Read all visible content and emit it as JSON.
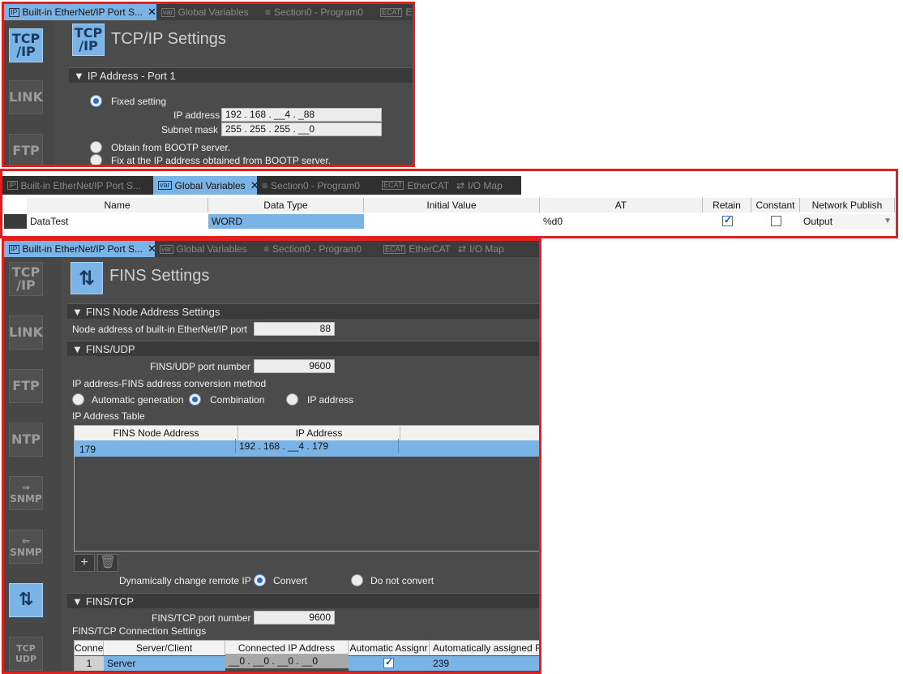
{
  "panel1": {
    "tabs": [
      {
        "icon": "IP",
        "label": "Built-in EtherNet/IP Port S...",
        "active": true,
        "closable": true
      },
      {
        "icon": "var",
        "label": "Global Variables",
        "active": false
      },
      {
        "icon": "",
        "label": "Section0 - Program0",
        "active": false
      },
      {
        "icon": "ECAT",
        "label": "Et",
        "active": false
      }
    ],
    "sidebar": [
      {
        "name": "tcpip",
        "line1": "TCP",
        "line2": "/IP",
        "selected": true
      },
      {
        "name": "link",
        "line1": "LINK",
        "line2": "",
        "selected": false
      },
      {
        "name": "ftp",
        "line1": "FTP",
        "line2": "",
        "selected": false
      }
    ],
    "header_icon": {
      "line1": "TCP",
      "line2": "/IP"
    },
    "title": "TCP/IP Settings",
    "section": "IP Address - Port 1",
    "fixed_setting_label": "Fixed setting",
    "ip_address_label": "IP address",
    "ip_address_value": "192 . 168 . __4 . _88",
    "subnet_mask_label": "Subnet mask",
    "subnet_mask_value": "255 . 255 . 255 . __0",
    "bootp_label": "Obtain from BOOTP server.",
    "fix_bootp_label": "Fix at the IP address obtained from BOOTP server."
  },
  "panel2": {
    "tabs": [
      {
        "icon": "IP",
        "label": "Built-in EtherNet/IP Port S...",
        "active": false
      },
      {
        "icon": "var",
        "label": "Global Variables",
        "active": true,
        "closable": true
      },
      {
        "icon": "",
        "label": "Section0 - Program0",
        "active": false
      },
      {
        "icon": "ECAT",
        "label": "EtherCAT",
        "active": false
      },
      {
        "icon": "",
        "label": "I/O Map",
        "active": false
      }
    ],
    "columns": [
      "Name",
      "Data Type",
      "Initial Value",
      "AT",
      "Retain",
      "Constant",
      "Network Publish"
    ],
    "row": {
      "name": "DataTest",
      "data_type": "WORD",
      "initial_value": "",
      "at": "%d0",
      "retain": true,
      "constant": false,
      "network_publish": "Output"
    }
  },
  "panel3": {
    "tabs": [
      {
        "icon": "IP",
        "label": "Built-in EtherNet/IP Port S...",
        "active": true,
        "closable": true
      },
      {
        "icon": "var",
        "label": "Global Variables",
        "active": false
      },
      {
        "icon": "",
        "label": "Section0 - Program0",
        "active": false
      },
      {
        "icon": "ECAT",
        "label": "EtherCAT",
        "active": false
      },
      {
        "icon": "",
        "label": "I/O Map",
        "active": false
      }
    ],
    "sidebar": [
      {
        "name": "tcpip",
        "line1": "TCP",
        "line2": "/IP",
        "selected": false
      },
      {
        "name": "link",
        "line1": "LINK",
        "line2": "",
        "selected": false
      },
      {
        "name": "ftp",
        "line1": "FTP",
        "line2": "",
        "selected": false
      },
      {
        "name": "ntp",
        "line1": "NTP",
        "line2": "",
        "selected": false
      },
      {
        "name": "snmp-out",
        "line1": "⇒",
        "line2": "SNMP",
        "selected": false
      },
      {
        "name": "snmp-in",
        "line1": "⇐",
        "line2": "SNMP",
        "selected": false
      },
      {
        "name": "fins",
        "line1": "⇅",
        "line2": "",
        "selected": true
      },
      {
        "name": "tcp-udp",
        "line1": "TCP",
        "line2": "UDP",
        "selected": false
      }
    ],
    "title": "FINS Settings",
    "node_section": "FINS Node Address Settings",
    "node_label": "Node address of built-in EtherNet/IP port",
    "node_value": "88",
    "udp_section": "FINS/UDP",
    "udp_port_label": "FINS/UDP port number",
    "udp_port_value": "9600",
    "conv_method_label": "IP address-FINS address conversion method",
    "conv_options": [
      "Automatic generation",
      "Combination",
      "IP address"
    ],
    "conv_selected": 1,
    "ip_table_label": "IP Address Table",
    "ip_table_columns": [
      "FINS Node Address",
      "IP Address"
    ],
    "ip_table_row": {
      "node": "179",
      "ip": "192 . 168 . __4 . 179"
    },
    "dyn_label": "Dynamically change remote IP",
    "dyn_options": [
      "Convert",
      "Do not convert"
    ],
    "dyn_selected": 0,
    "tcp_section": "FINS/TCP",
    "tcp_port_label": "FINS/TCP port number",
    "tcp_port_value": "9600",
    "tcp_conn_label": "FINS/TCP Connection Settings",
    "tcp_columns": [
      "Conne",
      "Server/Client",
      "Connected IP Address",
      "Automatic Assignr",
      "Automatically assigned FI"
    ],
    "tcp_row": {
      "conn": "1",
      "mode": "Server",
      "ip": "__0 . __0 . __0 . __0",
      "auto": true,
      "assigned": "239"
    }
  },
  "colors": {
    "accent": "#7ab3e6",
    "frame": "#e02020",
    "panel": "#4b4b4b"
  }
}
